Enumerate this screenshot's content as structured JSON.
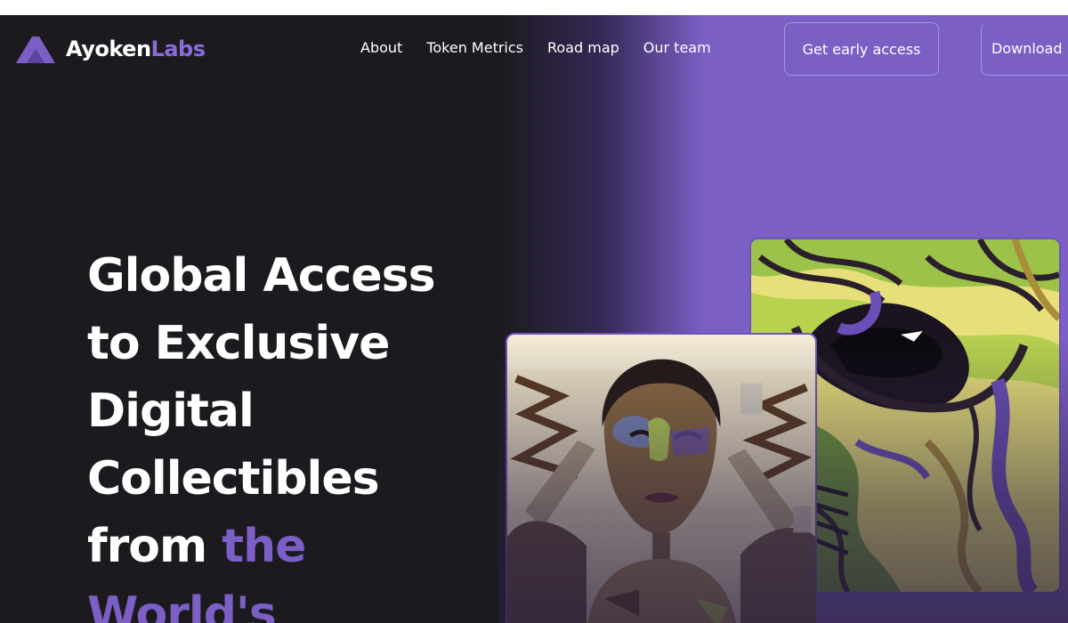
{
  "brand": {
    "name_main": "Ayoken",
    "name_accent": "Labs",
    "colors": {
      "accent": "#7b5fc4",
      "background": "#1c1a1e",
      "text": "#ffffff"
    }
  },
  "nav": {
    "items": [
      {
        "label": "About"
      },
      {
        "label": "Token Metrics"
      },
      {
        "label": "Road map"
      },
      {
        "label": "Our team"
      }
    ],
    "cta_early_access": "Get early access",
    "cta_download": "Download"
  },
  "hero": {
    "lines": [
      "Global Access",
      "to Exclusive",
      "Digital",
      "Collectibles"
    ],
    "line5_plain": "from ",
    "line5_accent": "the",
    "line6_accent": "World's"
  },
  "artwork": {
    "back_card_icon": "abstract-eye-artwork",
    "front_card_icon": "portrait-artwork"
  }
}
